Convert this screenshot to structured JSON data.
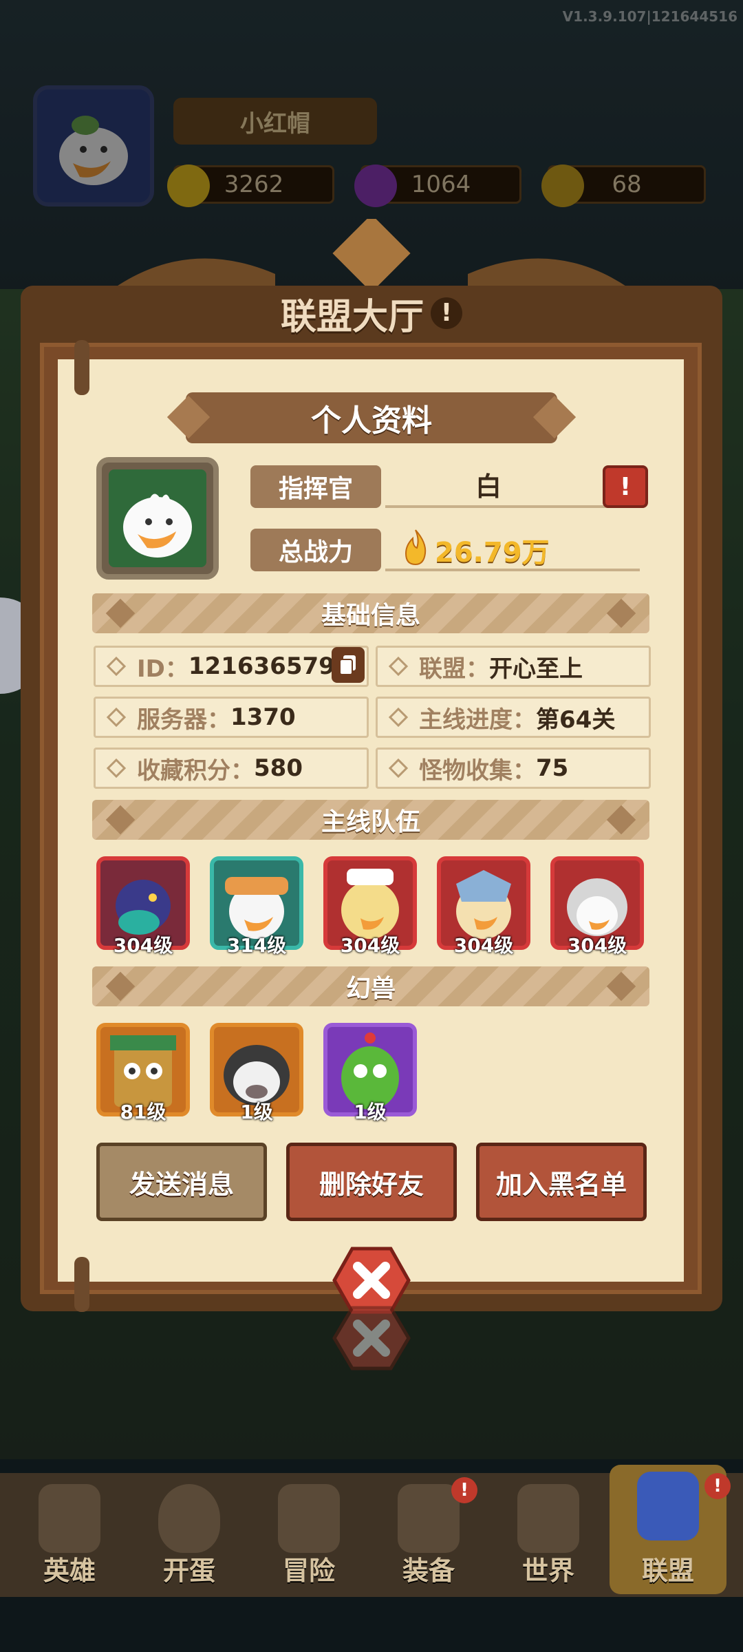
{
  "version": "V1.3.9.107|121644516",
  "player": {
    "name": "小红帽"
  },
  "resources": [
    {
      "icon": "gold-coin-icon",
      "value": "3262"
    },
    {
      "icon": "purple-gem-icon",
      "value": "1064"
    },
    {
      "icon": "medal-icon",
      "value": "68"
    }
  ],
  "hall": {
    "title": "联盟大厅",
    "info_icon": "!"
  },
  "profile": {
    "title": "个人资料",
    "commander_label": "指挥官",
    "commander_value": "白",
    "power_label": "总战力",
    "power_value": "26.79万",
    "report_icon": "!"
  },
  "basic_info": {
    "title": "基础信息",
    "id": {
      "label": "ID：",
      "value": "121636579"
    },
    "alliance": {
      "label": "联盟：",
      "value": "开心至上"
    },
    "server": {
      "label": "服务器：",
      "value": "1370"
    },
    "progress": {
      "label": "主线进度：",
      "value": "第64关"
    },
    "collection": {
      "label": "收藏积分：",
      "value": "580"
    },
    "monster": {
      "label": "怪物收集：",
      "value": "75"
    }
  },
  "team": {
    "title": "主线队伍",
    "heroes": [
      {
        "level": "304级",
        "frame": "#d63a3a",
        "bg": "#7a2a3a"
      },
      {
        "level": "314级",
        "frame": "#3ab8a8",
        "bg": "#2a7a6e"
      },
      {
        "level": "304级",
        "frame": "#d63a3a",
        "bg": "#b03030"
      },
      {
        "level": "304级",
        "frame": "#d63a3a",
        "bg": "#b03030"
      },
      {
        "level": "304级",
        "frame": "#d63a3a",
        "bg": "#b03030"
      }
    ]
  },
  "beasts": {
    "title": "幻兽",
    "items": [
      {
        "level": "81级",
        "frame": "#e08a2a",
        "bg": "#c87020"
      },
      {
        "level": "1级",
        "frame": "#e08a2a",
        "bg": "#c87020"
      },
      {
        "level": "1级",
        "frame": "#9a5ad6",
        "bg": "#7a3ab8"
      }
    ]
  },
  "actions": {
    "send_message": "发送消息",
    "delete_friend": "删除好友",
    "blacklist": "加入黑名单"
  },
  "bottom_nav": [
    {
      "label": "英雄",
      "badge": ""
    },
    {
      "label": "开蛋",
      "badge": ""
    },
    {
      "label": "冒险",
      "badge": ""
    },
    {
      "label": "装备",
      "badge": "!"
    },
    {
      "label": "世界",
      "badge": ""
    },
    {
      "label": "联盟",
      "badge": "!"
    }
  ]
}
